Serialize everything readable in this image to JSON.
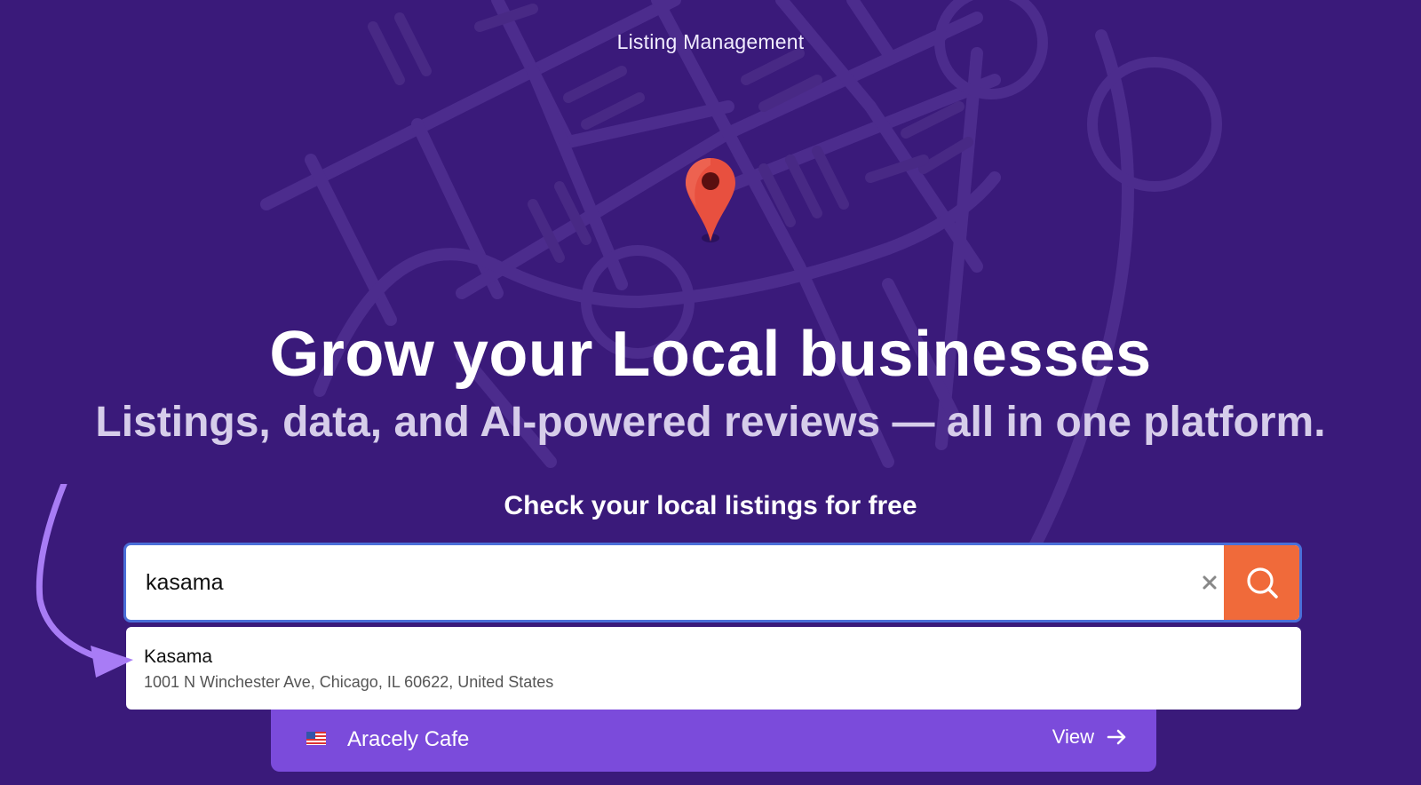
{
  "header": {
    "title": "Listing Management"
  },
  "hero": {
    "headline": "Grow your Local businesses",
    "subheadline": "Listings, data, and AI-powered reviews — all in one platform."
  },
  "search": {
    "title": "Check your local listings for free",
    "value": "kasama",
    "clear_icon": "close-icon",
    "submit_icon": "search-icon"
  },
  "suggestion": {
    "name": "Kasama",
    "address": "1001 N Winchester Ave, Chicago, IL 60622, United States"
  },
  "result": {
    "flag_icon": "us-flag-icon",
    "name": "Aracely Cafe",
    "action_label": "View"
  },
  "colors": {
    "background": "#3a1a7a",
    "accent": "#f06a3a",
    "card": "#7b4bdb",
    "input_border": "#4a6fd8",
    "annotation": "#a87cf5"
  }
}
